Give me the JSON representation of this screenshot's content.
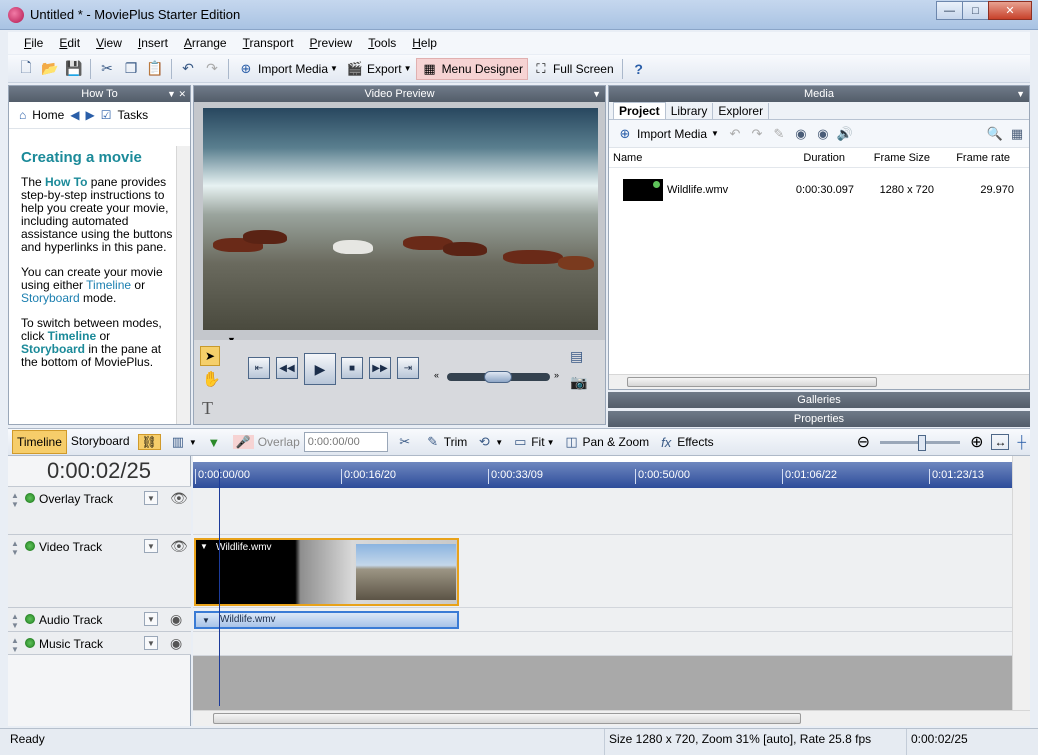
{
  "window": {
    "title": "Untitled * - MoviePlus Starter Edition",
    "btn_min": "—",
    "btn_max": "□",
    "btn_close": "✕"
  },
  "menubar": [
    "File",
    "Edit",
    "View",
    "Insert",
    "Arrange",
    "Transport",
    "Preview",
    "Tools",
    "Help"
  ],
  "toolbar": {
    "import_media": "Import Media",
    "export": "Export",
    "menu_designer": "Menu Designer",
    "full_screen": "Full Screen"
  },
  "howto": {
    "header": "How To",
    "nav_home": "Home",
    "nav_tasks": "Tasks",
    "title": "Creating a movie",
    "p1_a": "The ",
    "p1_hl": "How To",
    "p1_b": " pane provides step-by-step instructions to help you create your movie, including automated assistance using the buttons and hyperlinks in this pane.",
    "p2_a": "You can create your movie using either ",
    "p2_l1": "Timeline",
    "p2_b": " or ",
    "p2_l2": "Storyboard",
    "p2_c": " mode.",
    "p3_a": "To switch between modes, click ",
    "p3_h1": "Timeline",
    "p3_b": " or ",
    "p3_h2": "Storyboard",
    "p3_c": " in the pane at the bottom of MoviePlus."
  },
  "preview": {
    "header": "Video Preview"
  },
  "media": {
    "header": "Media",
    "tabs": [
      "Project",
      "Library",
      "Explorer"
    ],
    "import_media": "Import Media",
    "columns": [
      "Name",
      "Duration",
      "Frame Size",
      "Frame rate"
    ],
    "items": [
      {
        "name": "Wildlife.wmv",
        "duration": "0:00:30.097",
        "frame_size": "1280 x 720",
        "frame_rate": "29.970"
      }
    ]
  },
  "collapsed": {
    "galleries": "Galleries",
    "properties": "Properties"
  },
  "timeline_toolbar": {
    "tab_timeline": "Timeline",
    "tab_storyboard": "Storyboard",
    "overlap_label": "Overlap",
    "overlap_value": "0:00:00/00",
    "trim": "Trim",
    "fit": "Fit",
    "pan_zoom": "Pan & Zoom",
    "effects": "Effects"
  },
  "timeline": {
    "timecode": "0:00:02/25",
    "ruler": [
      "0:00:00/00",
      "0:00:16/20",
      "0:00:33/09",
      "0:00:50/00",
      "0:01:06/22",
      "0:01:23/13"
    ],
    "tracks": [
      "Overlay Track",
      "Video Track",
      "Audio Track",
      "Music Track"
    ],
    "video_clip": "Wildlife.wmv",
    "audio_clip": "Wildlife.wmv"
  },
  "status": {
    "ready": "Ready",
    "info": "Size 1280 x 720, Zoom 31% [auto], Rate 25.8 fps",
    "time": "0:00:02/25"
  }
}
